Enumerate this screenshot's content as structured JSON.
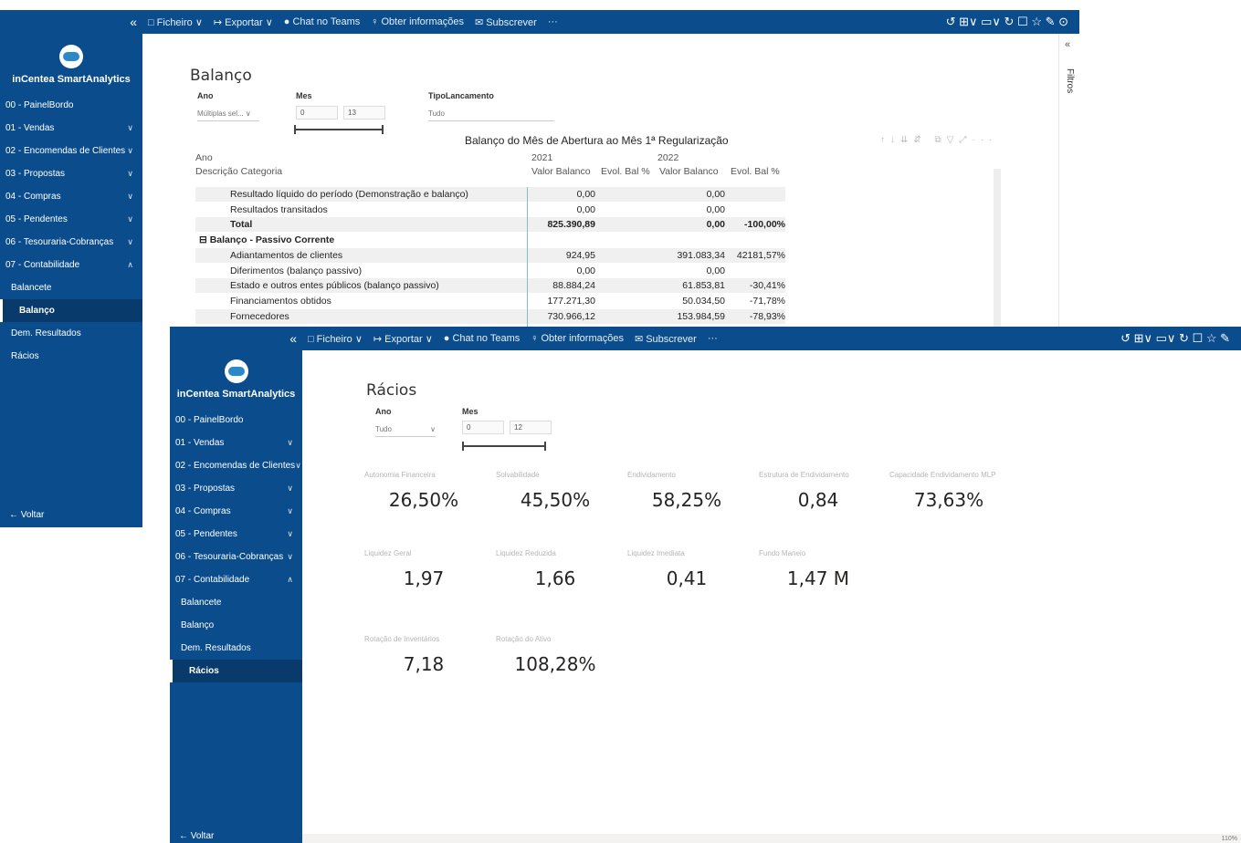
{
  "back_window": {
    "topbar": {
      "collapse_glyph": "«",
      "menu": [
        {
          "icon": "□",
          "label": "Ficheiro ∨"
        },
        {
          "icon": "↦",
          "label": "Exportar ∨"
        },
        {
          "icon": "●",
          "label": "Chat no Teams"
        },
        {
          "icon": "♀",
          "label": "Obter informações"
        },
        {
          "icon": "✉",
          "label": "Subscrever"
        },
        {
          "icon": "",
          "label": "···"
        }
      ],
      "right_icons": "↺  ⊞∨  ▭∨  ↻  ☐    ☆  ✎  ⊙"
    },
    "sidebar": {
      "brand": "inCentea SmartAnalytics",
      "items": [
        {
          "label": "00 - PainelBordo",
          "chev": ""
        },
        {
          "label": "01 - Vendas",
          "chev": "∨"
        },
        {
          "label": "02 - Encomendas de Clientes",
          "chev": "∨"
        },
        {
          "label": "03 - Propostas",
          "chev": "∨"
        },
        {
          "label": "04 - Compras",
          "chev": "∨"
        },
        {
          "label": "05 - Pendentes",
          "chev": "∨"
        },
        {
          "label": "06 - Tesouraria-Cobranças",
          "chev": "∨"
        },
        {
          "label": "07 - Contabilidade",
          "chev": "∧"
        }
      ],
      "subitems": [
        "Balancete",
        "Balanço",
        "Dem. Resultados",
        "Rácios"
      ],
      "active": "Balanço",
      "back": "←  Voltar"
    },
    "page": {
      "title": "Balanço",
      "slicers": {
        "ano_label": "Ano",
        "ano_value": "Múltiplas sel... ∨",
        "mes_label": "Mes",
        "mes_from": "0",
        "mes_to": "13",
        "tipo_label": "TipoLancamento",
        "tipo_value": "Tudo"
      },
      "filters_label": "Filtros",
      "filters_arrow": "«",
      "table": {
        "title": "Balanço do Mês de Abertura ao Mês 1ª Regularização",
        "icons": "↑↓⇊⇵ ⧉▽⤢···",
        "header_row1": [
          "Ano",
          "2021",
          "",
          "2022",
          ""
        ],
        "header_row2": [
          "Descrição Categoria",
          "Valor Balanco",
          "Evol. Bal %",
          "Valor Balanco",
          "Evol. Bal %"
        ],
        "rows": [
          {
            "label": "Resultado líquido do período (Demonstração e balanço)",
            "v1": "0,00",
            "e1": "",
            "v2": "0,00",
            "e2": "",
            "style": "shade",
            "indent": 2
          },
          {
            "label": "Resultados transitados",
            "v1": "0,00",
            "e1": "",
            "v2": "0,00",
            "e2": "",
            "style": "",
            "indent": 2
          },
          {
            "label": "Total",
            "v1": "825.390,89",
            "e1": "",
            "v2": "0,00",
            "e2": "-100,00%",
            "style": "shade bold",
            "indent": 2
          },
          {
            "label": "⊟  Balanço - Passivo Corrente",
            "v1": "",
            "e1": "",
            "v2": "",
            "e2": "",
            "style": "bold",
            "indent": 1
          },
          {
            "label": "Adiantamentos de clientes",
            "v1": "924,95",
            "e1": "",
            "v2": "391.083,34",
            "e2": "42181,57%",
            "style": "shade",
            "indent": 2
          },
          {
            "label": "Diferimentos (balanço passivo)",
            "v1": "0,00",
            "e1": "",
            "v2": "0,00",
            "e2": "",
            "style": "",
            "indent": 2
          },
          {
            "label": "Estado e outros entes públicos (balanço passivo)",
            "v1": "88.884,24",
            "e1": "",
            "v2": "61.853,81",
            "e2": "-30,41%",
            "style": "shade",
            "indent": 2
          },
          {
            "label": "Financiamentos obtidos",
            "v1": "177.271,30",
            "e1": "",
            "v2": "50.034,50",
            "e2": "-71,78%",
            "style": "",
            "indent": 2
          },
          {
            "label": "Fornecedores",
            "v1": "730.966,12",
            "e1": "",
            "v2": "153.984,59",
            "e2": "-78,93%",
            "style": "shade",
            "indent": 2
          }
        ]
      }
    }
  },
  "front_window": {
    "topbar": {
      "collapse_glyph": "«",
      "menu": [
        {
          "icon": "□",
          "label": "Ficheiro ∨"
        },
        {
          "icon": "↦",
          "label": "Exportar ∨"
        },
        {
          "icon": "●",
          "label": "Chat no Teams"
        },
        {
          "icon": "♀",
          "label": "Obter informações"
        },
        {
          "icon": "✉",
          "label": "Subscrever"
        },
        {
          "icon": "",
          "label": "···"
        }
      ],
      "right_icons": "↺  ⊞∨  ▭∨  ↻  ☐    ☆  ✎"
    },
    "sidebar": {
      "brand": "inCentea SmartAnalytics",
      "items": [
        {
          "label": "00 - PainelBordo",
          "chev": ""
        },
        {
          "label": "01 - Vendas",
          "chev": "∨"
        },
        {
          "label": "02 - Encomendas de Clientes",
          "chev": "∨"
        },
        {
          "label": "03 - Propostas",
          "chev": "∨"
        },
        {
          "label": "04 - Compras",
          "chev": "∨"
        },
        {
          "label": "05 - Pendentes",
          "chev": "∨"
        },
        {
          "label": "06 - Tesouraria-Cobranças",
          "chev": "∨"
        },
        {
          "label": "07 - Contabilidade",
          "chev": "∧"
        }
      ],
      "subitems": [
        "Balancete",
        "Balanço",
        "Dem. Resultados",
        "Rácios"
      ],
      "active": "Rácios",
      "back": "←  Voltar"
    },
    "page": {
      "title": "Rácios",
      "slicers": {
        "ano_label": "Ano",
        "ano_value": "Tudo",
        "ano_chevron": "∨",
        "mes_label": "Mes",
        "mes_from": "0",
        "mes_to": "12"
      },
      "kpis": [
        {
          "label": "Autonomia Financeira",
          "value": "26,50%"
        },
        {
          "label": "Solvabilidade",
          "value": "45,50%"
        },
        {
          "label": "Endividamento",
          "value": "58,25%"
        },
        {
          "label": "Estrutura de Endividamento",
          "value": "0,84"
        },
        {
          "label": "Capacidade Endividamento MLP",
          "value": "73,63%"
        },
        {
          "label": "Liquidez Geral",
          "value": "1,97"
        },
        {
          "label": "Liquidez Reduzida",
          "value": "1,66"
        },
        {
          "label": "Liquidez Imediata",
          "value": "0,41"
        },
        {
          "label": "Fundo Maneio",
          "value": "1,47 M"
        },
        {
          "label": "Rotação de Inventários",
          "value": "7,18"
        },
        {
          "label": "Rotação do Ativo",
          "value": "108,28%"
        }
      ],
      "zoom": "110%"
    }
  },
  "colors": {
    "brand_blue": "#0b4d8c",
    "active_blue": "#083a6b"
  }
}
